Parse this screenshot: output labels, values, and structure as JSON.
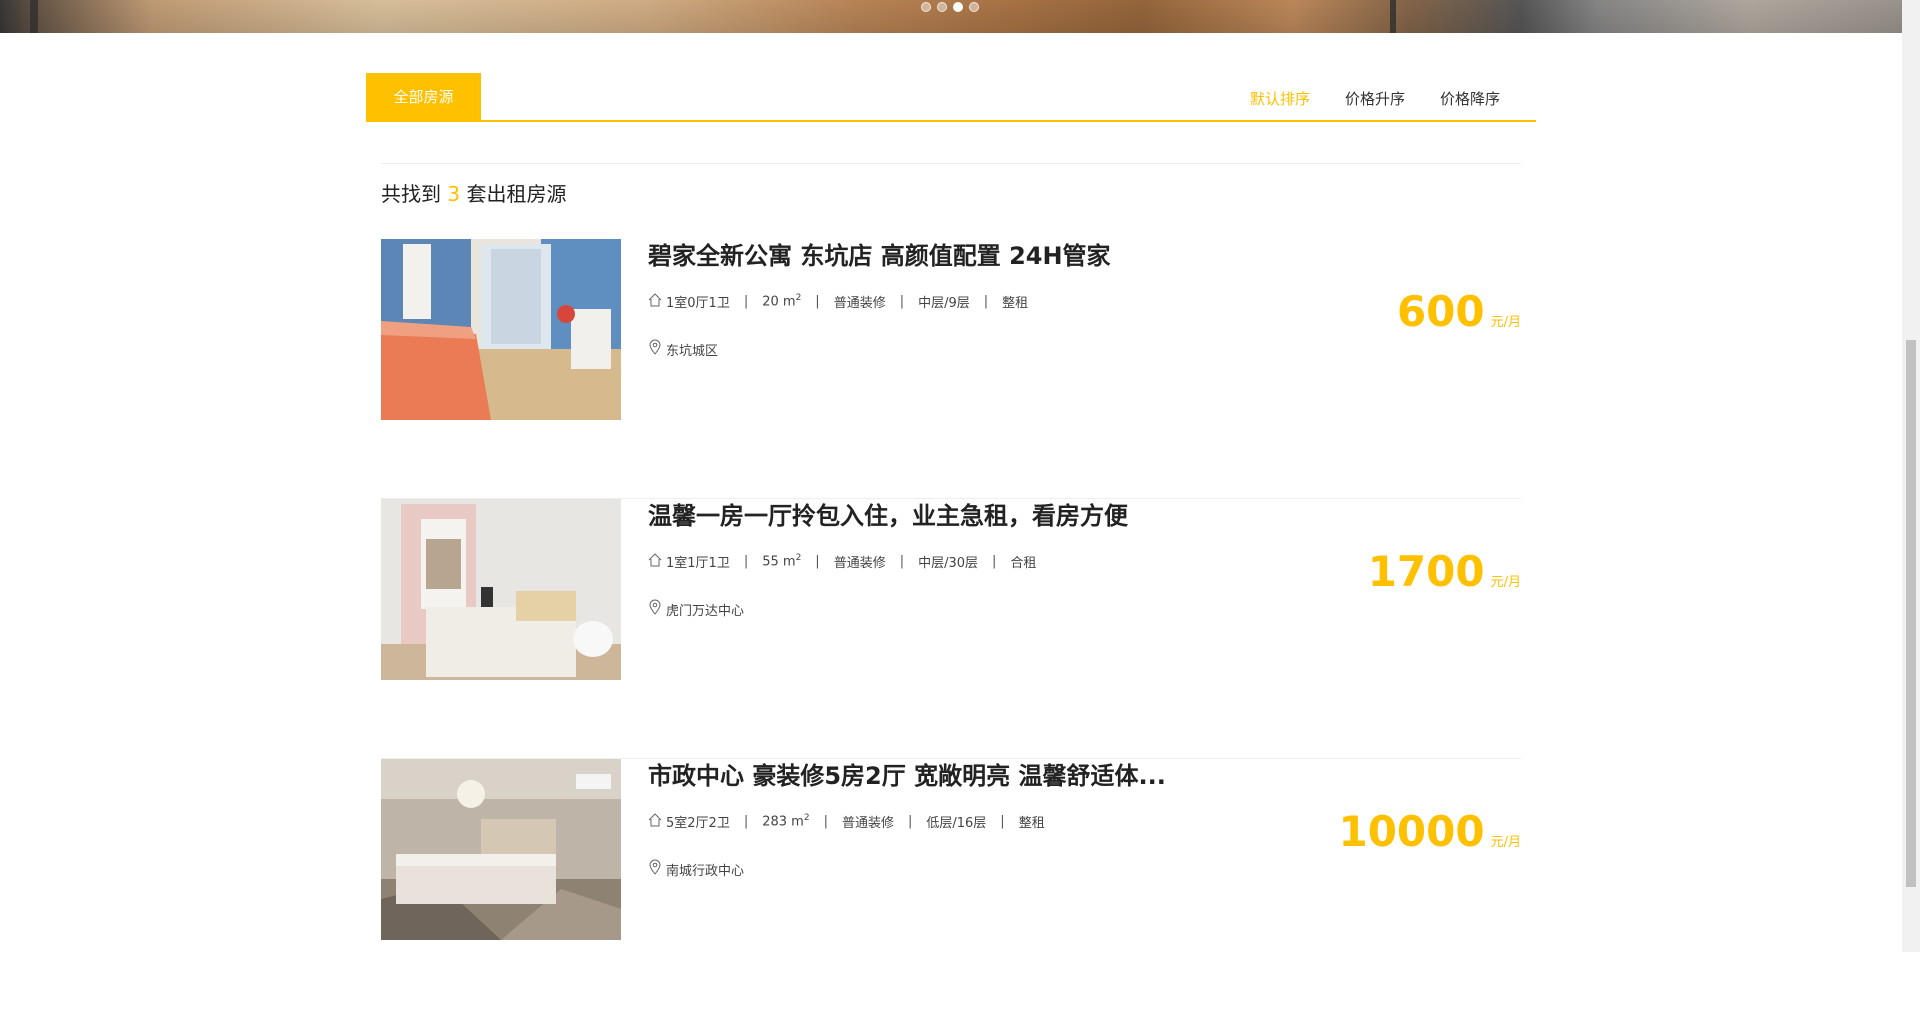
{
  "banner": {
    "slides": [
      {
        "label": "slide-1",
        "active": false
      },
      {
        "label": "slide-2",
        "active": false
      },
      {
        "label": "slide-3",
        "active": true
      },
      {
        "label": "slide-4",
        "active": false
      }
    ]
  },
  "tabs": {
    "all_label": "全部房源",
    "sort_default": "默认排序",
    "sort_price_asc": "价格升序",
    "sort_price_desc": "价格降序"
  },
  "summary": {
    "prefix": "共找到",
    "count": "3",
    "suffix": "套出租房源"
  },
  "listings": [
    {
      "title": "碧家全新公寓 东坑店 高颜值配置 24H管家",
      "layout": "1室0厅1卫",
      "area": "20 m",
      "area_sup": "2",
      "decoration": "普通装修",
      "floor": "中层/9层",
      "rent_type": "整租",
      "location": "东坑城区",
      "price": "600",
      "unit": "元/月"
    },
    {
      "title": "温馨一房一厅拎包入住，业主急租，看房方便",
      "layout": "1室1厅1卫",
      "area": "55 m",
      "area_sup": "2",
      "decoration": "普通装修",
      "floor": "中层/30层",
      "rent_type": "合租",
      "location": "虎门万达中心",
      "price": "1700",
      "unit": "元/月"
    },
    {
      "title": "市政中心 豪装修5房2厅 宽敞明亮 温馨舒适体...",
      "layout": "5室2厅2卫",
      "area": "283 m",
      "area_sup": "2",
      "decoration": "普通装修",
      "floor": "低层/16层",
      "rent_type": "整租",
      "location": "南城行政中心",
      "price": "10000",
      "unit": "元/月"
    }
  ],
  "colors": {
    "accent": "#ffc000",
    "text": "#333333"
  },
  "icons": [
    "house-icon",
    "location-pin-icon"
  ]
}
